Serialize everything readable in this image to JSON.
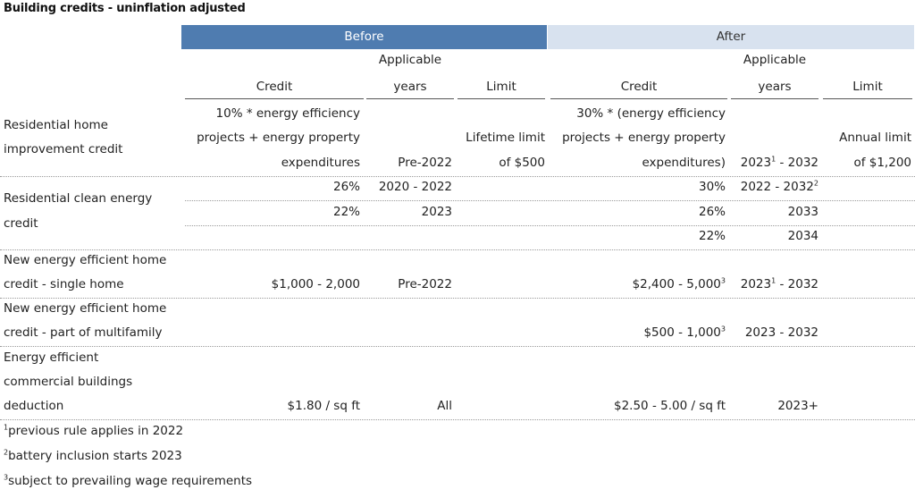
{
  "title": "Building credits - uninflation adjusted",
  "groups": {
    "before": "Before",
    "after": "After"
  },
  "headers": {
    "credit": "Credit",
    "applicable": "Applicable",
    "years": "years",
    "limit": "Limit"
  },
  "rows": [
    {
      "label": [
        "Residential home",
        "improvement credit"
      ],
      "before_credit": [
        "10% * energy efficiency",
        "projects + energy property",
        "expenditures"
      ],
      "before_years": "Pre-2022",
      "before_limit": [
        "Lifetime limit",
        "of $500"
      ],
      "after_credit": [
        "30% * (energy efficiency",
        "projects + energy property",
        "expenditures)"
      ],
      "after_years": "2023",
      "after_years_sup": "1",
      "after_years_end": " - 2032",
      "after_limit": [
        "Annual limit",
        "of $1,200"
      ]
    },
    {
      "label": [
        "Residential clean energy",
        "credit"
      ],
      "sub": [
        {
          "before_credit": "26%",
          "before_years": "2020 - 2022",
          "after_credit": "30%",
          "after_years": "2022 - 2032",
          "after_years_sup": "2"
        },
        {
          "before_credit": "22%",
          "before_years": "2023",
          "after_credit": "26%",
          "after_years": "2033"
        },
        {
          "after_credit": "22%",
          "after_years": "2034"
        }
      ]
    },
    {
      "label": [
        "New energy efficient home",
        "credit - single home"
      ],
      "before_credit": "$1,000 - 2,000",
      "before_years": "Pre-2022",
      "after_credit": "$2,400 - 5,000",
      "after_credit_sup": "3",
      "after_years": "2023",
      "after_years_sup": "1",
      "after_years_end": " - 2032"
    },
    {
      "label": [
        "New energy efficient home",
        "credit - part of multifamily"
      ],
      "after_credit": "$500 - 1,000",
      "after_credit_sup": "3",
      "after_years": "2023 - 2032"
    },
    {
      "label": [
        "Energy efficient",
        "commercial buildings",
        "deduction"
      ],
      "before_credit": "$1.80 / sq ft",
      "before_years": "All",
      "after_credit": "$2.50 - 5.00 / sq ft",
      "after_years": "2023+"
    }
  ],
  "footnotes": [
    {
      "mark": "1",
      "text": "previous rule applies in 2022"
    },
    {
      "mark": "2",
      "text": "battery inclusion starts 2023"
    },
    {
      "mark": "3",
      "text": "subject to prevailing wage requirements"
    }
  ]
}
